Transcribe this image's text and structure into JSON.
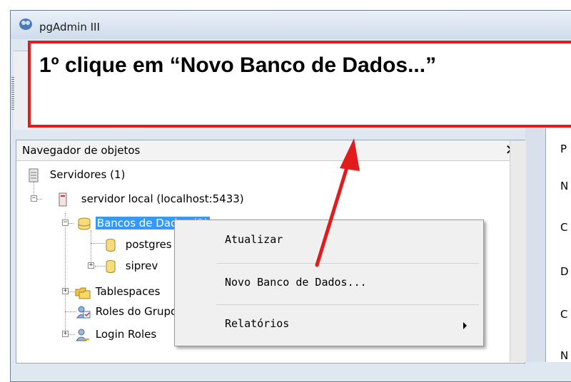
{
  "app": {
    "title": "pgAdmin III"
  },
  "annotation": {
    "text": "1º clique em “Novo Banco de Dados...”"
  },
  "panel": {
    "title": "Navegador de objetos",
    "close_glyph": "✕"
  },
  "tree": {
    "servers": "Servidores (1)",
    "server": "servidor local (localhost:5433)",
    "databases": "Bancos de Dados (2)",
    "db1": "postgres",
    "db2": "siprev",
    "tablespaces": "Tablespaces",
    "group_roles": "Roles do Grupo",
    "login_roles": "Login Roles"
  },
  "context_menu": {
    "items": [
      "Atualizar",
      "Novo Banco de Dados...",
      "Relatórios"
    ]
  },
  "properties_column": [
    "P",
    "N",
    "C",
    "D",
    "C",
    "N"
  ],
  "colors": {
    "annotation": "#e21c1c",
    "selection": "#3399ff"
  }
}
